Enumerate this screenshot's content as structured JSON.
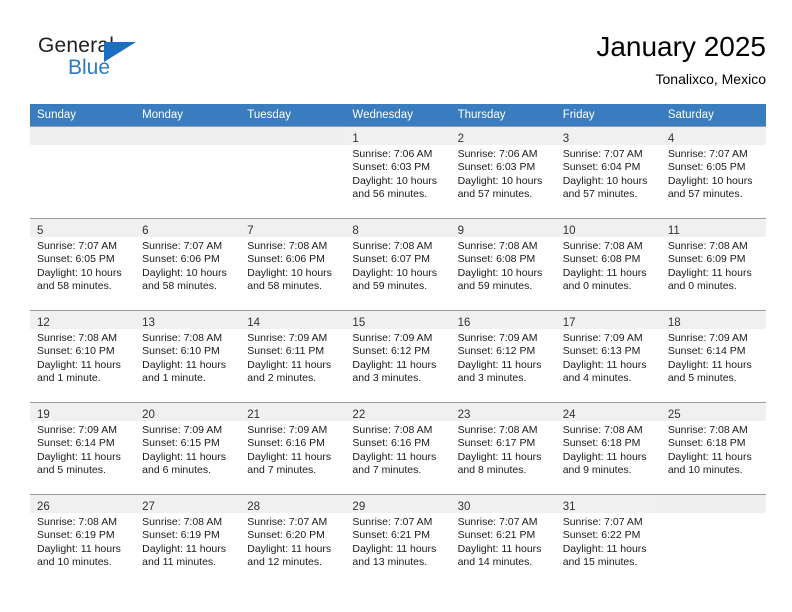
{
  "brand": {
    "name_part1": "General",
    "name_part2": "Blue",
    "flag_icon": "triangle-flag-icon"
  },
  "header": {
    "title": "January 2025",
    "subtitle": "Tonalixco, Mexico"
  },
  "colors": {
    "header_blue": "#3a7cc0",
    "brand_blue": "#2b7cc0",
    "daynum_band": "#efefef",
    "grid_line": "#9c9c9c",
    "text": "#1a1a1a"
  },
  "weekdays": [
    "Sunday",
    "Monday",
    "Tuesday",
    "Wednesday",
    "Thursday",
    "Friday",
    "Saturday"
  ],
  "labels": {
    "sunrise_prefix": "Sunrise:",
    "sunset_prefix": "Sunset:",
    "daylight_prefix": "Daylight:"
  },
  "weeks": [
    [
      {
        "day": "",
        "l1": "",
        "l2": "",
        "l3": "",
        "l4": ""
      },
      {
        "day": "",
        "l1": "",
        "l2": "",
        "l3": "",
        "l4": ""
      },
      {
        "day": "",
        "l1": "",
        "l2": "",
        "l3": "",
        "l4": ""
      },
      {
        "day": "1",
        "l1": "Sunrise: 7:06 AM",
        "l2": "Sunset: 6:03 PM",
        "l3": "Daylight: 10 hours",
        "l4": "and 56 minutes."
      },
      {
        "day": "2",
        "l1": "Sunrise: 7:06 AM",
        "l2": "Sunset: 6:03 PM",
        "l3": "Daylight: 10 hours",
        "l4": "and 57 minutes."
      },
      {
        "day": "3",
        "l1": "Sunrise: 7:07 AM",
        "l2": "Sunset: 6:04 PM",
        "l3": "Daylight: 10 hours",
        "l4": "and 57 minutes."
      },
      {
        "day": "4",
        "l1": "Sunrise: 7:07 AM",
        "l2": "Sunset: 6:05 PM",
        "l3": "Daylight: 10 hours",
        "l4": "and 57 minutes."
      }
    ],
    [
      {
        "day": "5",
        "l1": "Sunrise: 7:07 AM",
        "l2": "Sunset: 6:05 PM",
        "l3": "Daylight: 10 hours",
        "l4": "and 58 minutes."
      },
      {
        "day": "6",
        "l1": "Sunrise: 7:07 AM",
        "l2": "Sunset: 6:06 PM",
        "l3": "Daylight: 10 hours",
        "l4": "and 58 minutes."
      },
      {
        "day": "7",
        "l1": "Sunrise: 7:08 AM",
        "l2": "Sunset: 6:06 PM",
        "l3": "Daylight: 10 hours",
        "l4": "and 58 minutes."
      },
      {
        "day": "8",
        "l1": "Sunrise: 7:08 AM",
        "l2": "Sunset: 6:07 PM",
        "l3": "Daylight: 10 hours",
        "l4": "and 59 minutes."
      },
      {
        "day": "9",
        "l1": "Sunrise: 7:08 AM",
        "l2": "Sunset: 6:08 PM",
        "l3": "Daylight: 10 hours",
        "l4": "and 59 minutes."
      },
      {
        "day": "10",
        "l1": "Sunrise: 7:08 AM",
        "l2": "Sunset: 6:08 PM",
        "l3": "Daylight: 11 hours",
        "l4": "and 0 minutes."
      },
      {
        "day": "11",
        "l1": "Sunrise: 7:08 AM",
        "l2": "Sunset: 6:09 PM",
        "l3": "Daylight: 11 hours",
        "l4": "and 0 minutes."
      }
    ],
    [
      {
        "day": "12",
        "l1": "Sunrise: 7:08 AM",
        "l2": "Sunset: 6:10 PM",
        "l3": "Daylight: 11 hours",
        "l4": "and 1 minute."
      },
      {
        "day": "13",
        "l1": "Sunrise: 7:08 AM",
        "l2": "Sunset: 6:10 PM",
        "l3": "Daylight: 11 hours",
        "l4": "and 1 minute."
      },
      {
        "day": "14",
        "l1": "Sunrise: 7:09 AM",
        "l2": "Sunset: 6:11 PM",
        "l3": "Daylight: 11 hours",
        "l4": "and 2 minutes."
      },
      {
        "day": "15",
        "l1": "Sunrise: 7:09 AM",
        "l2": "Sunset: 6:12 PM",
        "l3": "Daylight: 11 hours",
        "l4": "and 3 minutes."
      },
      {
        "day": "16",
        "l1": "Sunrise: 7:09 AM",
        "l2": "Sunset: 6:12 PM",
        "l3": "Daylight: 11 hours",
        "l4": "and 3 minutes."
      },
      {
        "day": "17",
        "l1": "Sunrise: 7:09 AM",
        "l2": "Sunset: 6:13 PM",
        "l3": "Daylight: 11 hours",
        "l4": "and 4 minutes."
      },
      {
        "day": "18",
        "l1": "Sunrise: 7:09 AM",
        "l2": "Sunset: 6:14 PM",
        "l3": "Daylight: 11 hours",
        "l4": "and 5 minutes."
      }
    ],
    [
      {
        "day": "19",
        "l1": "Sunrise: 7:09 AM",
        "l2": "Sunset: 6:14 PM",
        "l3": "Daylight: 11 hours",
        "l4": "and 5 minutes."
      },
      {
        "day": "20",
        "l1": "Sunrise: 7:09 AM",
        "l2": "Sunset: 6:15 PM",
        "l3": "Daylight: 11 hours",
        "l4": "and 6 minutes."
      },
      {
        "day": "21",
        "l1": "Sunrise: 7:09 AM",
        "l2": "Sunset: 6:16 PM",
        "l3": "Daylight: 11 hours",
        "l4": "and 7 minutes."
      },
      {
        "day": "22",
        "l1": "Sunrise: 7:08 AM",
        "l2": "Sunset: 6:16 PM",
        "l3": "Daylight: 11 hours",
        "l4": "and 7 minutes."
      },
      {
        "day": "23",
        "l1": "Sunrise: 7:08 AM",
        "l2": "Sunset: 6:17 PM",
        "l3": "Daylight: 11 hours",
        "l4": "and 8 minutes."
      },
      {
        "day": "24",
        "l1": "Sunrise: 7:08 AM",
        "l2": "Sunset: 6:18 PM",
        "l3": "Daylight: 11 hours",
        "l4": "and 9 minutes."
      },
      {
        "day": "25",
        "l1": "Sunrise: 7:08 AM",
        "l2": "Sunset: 6:18 PM",
        "l3": "Daylight: 11 hours",
        "l4": "and 10 minutes."
      }
    ],
    [
      {
        "day": "26",
        "l1": "Sunrise: 7:08 AM",
        "l2": "Sunset: 6:19 PM",
        "l3": "Daylight: 11 hours",
        "l4": "and 10 minutes."
      },
      {
        "day": "27",
        "l1": "Sunrise: 7:08 AM",
        "l2": "Sunset: 6:19 PM",
        "l3": "Daylight: 11 hours",
        "l4": "and 11 minutes."
      },
      {
        "day": "28",
        "l1": "Sunrise: 7:07 AM",
        "l2": "Sunset: 6:20 PM",
        "l3": "Daylight: 11 hours",
        "l4": "and 12 minutes."
      },
      {
        "day": "29",
        "l1": "Sunrise: 7:07 AM",
        "l2": "Sunset: 6:21 PM",
        "l3": "Daylight: 11 hours",
        "l4": "and 13 minutes."
      },
      {
        "day": "30",
        "l1": "Sunrise: 7:07 AM",
        "l2": "Sunset: 6:21 PM",
        "l3": "Daylight: 11 hours",
        "l4": "and 14 minutes."
      },
      {
        "day": "31",
        "l1": "Sunrise: 7:07 AM",
        "l2": "Sunset: 6:22 PM",
        "l3": "Daylight: 11 hours",
        "l4": "and 15 minutes."
      },
      {
        "day": "",
        "l1": "",
        "l2": "",
        "l3": "",
        "l4": ""
      }
    ]
  ]
}
